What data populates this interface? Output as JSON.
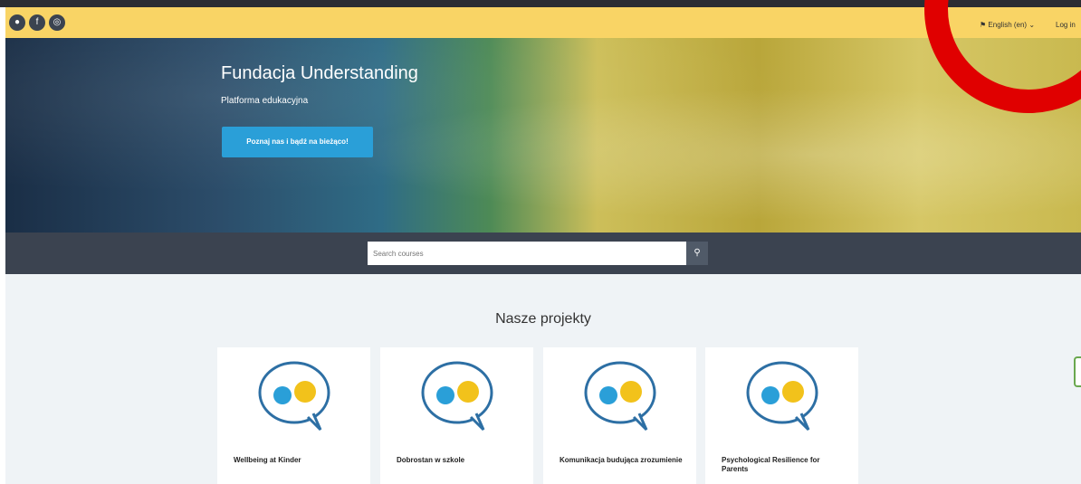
{
  "topbar": {
    "social_icons": [
      "moodle-icon",
      "facebook-icon",
      "instagram-icon"
    ],
    "language": "English (en)",
    "login": "Log in"
  },
  "hero": {
    "title": "Fundacja Understanding",
    "subtitle": "Platforma edukacyjna",
    "button": "Poznaj nas i bądź na bieżąco!"
  },
  "search": {
    "placeholder": "Search courses"
  },
  "projects": {
    "title": "Nasze projekty",
    "cards": [
      {
        "title": "Wellbeing at Kinder"
      },
      {
        "title": "Dobrostan w szkole"
      },
      {
        "title": "Komunikacja budująca zrozumienie"
      },
      {
        "title": "Psychological Resilience for Parents"
      }
    ]
  },
  "colors": {
    "topbar": "#f9d465",
    "search_band": "#3b4350",
    "button": "#2a9fd8",
    "annotation": "#e00000"
  }
}
